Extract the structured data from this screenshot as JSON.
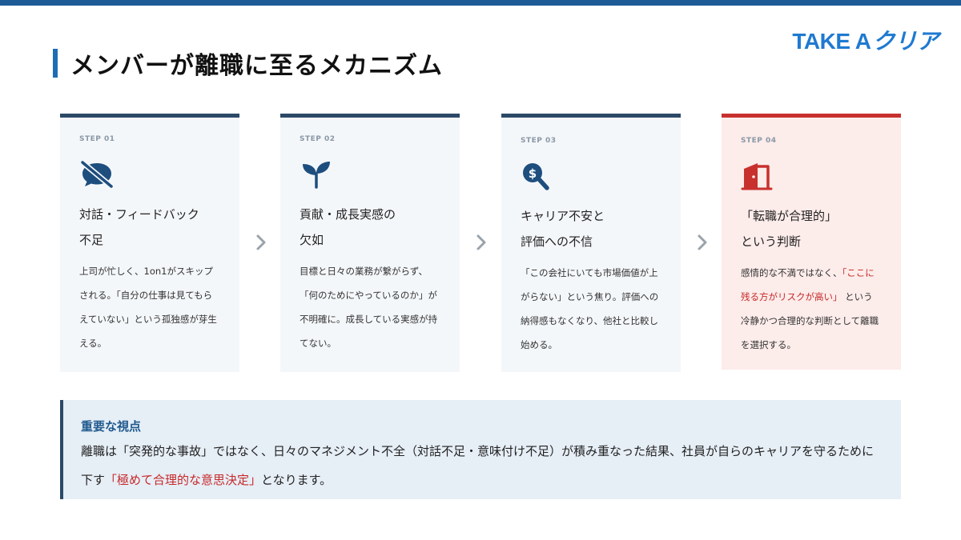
{
  "page": {
    "title": "メンバーが離職に至るメカニズム",
    "logo_main": "TAKE A",
    "logo_kana": "クリア"
  },
  "colors": {
    "accent": "#1f6cb4",
    "step_border": "#2c4a68",
    "alert": "#c8302e",
    "highlight_text": "#c62828"
  },
  "steps": [
    {
      "label": "STEP 01",
      "icon": "no-chat-icon",
      "title_line1": "対話・フィードバック",
      "title_line2": "不足",
      "body": "上司が忙しく、1on1がスキップされる。「自分の仕事は見てもらえていない」という孤独感が芽生える。"
    },
    {
      "label": "STEP 02",
      "icon": "sprout-icon",
      "title_line1": "貢献・成長実感の",
      "title_line2": "欠如",
      "body": "目標と日々の業務が繋がらず、「何のためにやっているのか」が不明確に。成長している実感が持てない。"
    },
    {
      "label": "STEP 03",
      "icon": "search-dollar-icon",
      "title_line1": "キャリア不安と",
      "title_line2": "評価への不信",
      "body": "「この会社にいても市場価値が上がらない」という焦り。評価への納得感もなくなり、他社と比較し始める。"
    },
    {
      "label": "STEP 04",
      "icon": "door-exit-icon",
      "title_line1": "「転職が合理的」",
      "title_line2": "という判断",
      "body_pre": "感情的な不満ではなく、",
      "body_highlight": "「ここに残る方がリスクが高い」",
      "body_post": " という冷静かつ合理的な判断として離職を選択する。"
    }
  ],
  "insight": {
    "heading": "重要な視点",
    "text_pre": "離職は「突発的な事故」ではなく、日々のマネジメント不全（対話不足・意味付け不足）が積み重なった結果、社員が自らのキャリアを守るために下す",
    "text_highlight": "「極めて合理的な意思決定」",
    "text_post": "となります。"
  }
}
